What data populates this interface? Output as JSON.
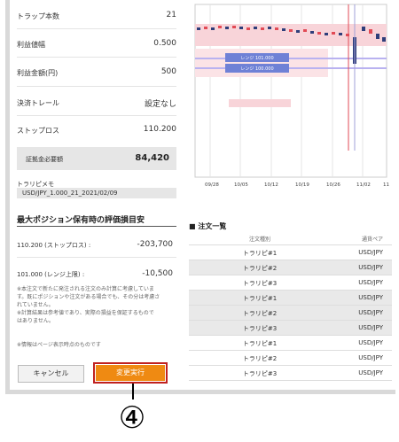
{
  "settings": {
    "trap_count": {
      "label": "トラップ本数",
      "value": "21"
    },
    "profit_width": {
      "label": "利益値幅",
      "value": "0.500"
    },
    "profit_amount": {
      "label": "利益金額(円)",
      "value": "500"
    },
    "trailing": {
      "label": "決済トレール",
      "value": "設定なし"
    },
    "stop_loss": {
      "label": "ストップロス",
      "value": "110.200"
    },
    "margin": {
      "label": "証拠金必要額",
      "value": "84,420"
    },
    "memo": {
      "label": "トラリピメモ",
      "value": "USD/JPY_1.000_21_2021/02/09"
    }
  },
  "evaluation": {
    "title": "最大ポジション保有時の評価損目安",
    "rows": [
      {
        "label": "110.200 (ストップロス) :",
        "value": "-203,700"
      },
      {
        "label": "101.000 (レンジ上限) :",
        "value": "-10,500"
      }
    ],
    "note_lines": [
      "※本注文で新たに発注される注文のみ計算に考慮していま",
      "す。既にポジションや注文がある場合でも、その分は考慮さ",
      "れていません。",
      "※計算結果は参考値であり、実際の損益を保証するもので",
      "はありません。"
    ],
    "note2": "※情報はページ表示時点のものです"
  },
  "buttons": {
    "cancel": "キャンセル",
    "execute": "変更実行"
  },
  "callout": "④",
  "chart": {
    "range_labels": [
      "レンジ 101.000",
      "レンジ 100.000"
    ],
    "x_ticks": [
      "09/28",
      "10/05",
      "10/12",
      "10/19",
      "10/26",
      "11/02",
      "11"
    ]
  },
  "orders": {
    "title": "■ 注文一覧",
    "headers": [
      "注文種別",
      "通貨ペア"
    ],
    "rows": [
      {
        "type": "トラリピ#1",
        "pair": "USD/JPY"
      },
      {
        "type": "トラリピ#2",
        "pair": "USD/JPY"
      },
      {
        "type": "トラリピ#3",
        "pair": "USD/JPY"
      },
      {
        "type": "トラリピ#1",
        "pair": "USD/JPY"
      },
      {
        "type": "トラリピ#2",
        "pair": "USD/JPY"
      },
      {
        "type": "トラリピ#3",
        "pair": "USD/JPY"
      },
      {
        "type": "トラリピ#1",
        "pair": "USD/JPY"
      },
      {
        "type": "トラリピ#2",
        "pair": "USD/JPY"
      },
      {
        "type": "トラリピ#3",
        "pair": "USD/JPY"
      }
    ]
  }
}
